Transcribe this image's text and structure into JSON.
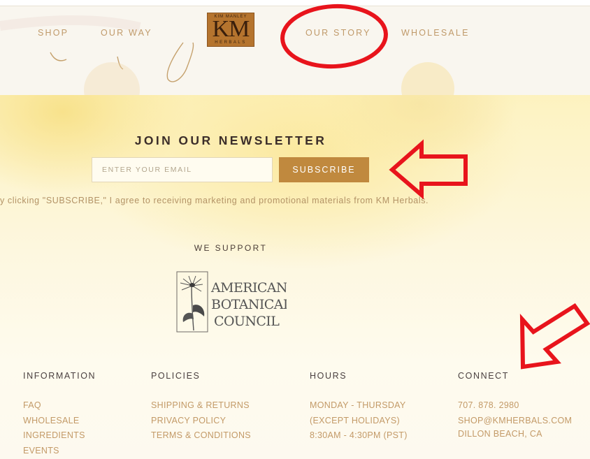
{
  "nav": {
    "items": [
      {
        "label": "SHOP"
      },
      {
        "label": "OUR WAY"
      },
      {
        "label": "OUR STORY"
      },
      {
        "label": "WHOLESALE"
      }
    ],
    "logo": {
      "top": "KIM MANLEY",
      "mid": "KM",
      "bottom": "HERBALS"
    }
  },
  "newsletter": {
    "title": "JOIN OUR NEWSLETTER",
    "email_placeholder": "ENTER YOUR EMAIL",
    "email_value": "",
    "subscribe_label": "SUBSCRIBE",
    "consent": "y clicking \"SUBSCRIBE,\" I agree to receiving marketing and promotional materials from KM Herbals."
  },
  "support": {
    "heading": "WE SUPPORT",
    "org_lines": [
      "AMERICAN",
      "BOTANICAL",
      "COUNCIL"
    ]
  },
  "footer": {
    "information": {
      "heading": "INFORMATION",
      "links": [
        "FAQ",
        "WHOLESALE",
        "INGREDIENTS",
        "EVENTS"
      ]
    },
    "policies": {
      "heading": "POLICIES",
      "links": [
        "SHIPPING & RETURNS",
        "PRIVACY POLICY",
        "TERMS & CONDITIONS"
      ]
    },
    "hours": {
      "heading": "HOURS",
      "lines": [
        "MONDAY - THURSDAY",
        "(EXCEPT HOLIDAYS)",
        "8:30AM - 4:30PM (PST)"
      ]
    },
    "connect": {
      "heading": "CONNECT",
      "lines": [
        "707. 878. 2980",
        "SHOP@KMHERBALS.COM",
        "DILLON BEACH, CA"
      ]
    }
  },
  "colors": {
    "accent": "#c0893e",
    "link": "#c39a67",
    "annotation_red": "#e8141c"
  }
}
